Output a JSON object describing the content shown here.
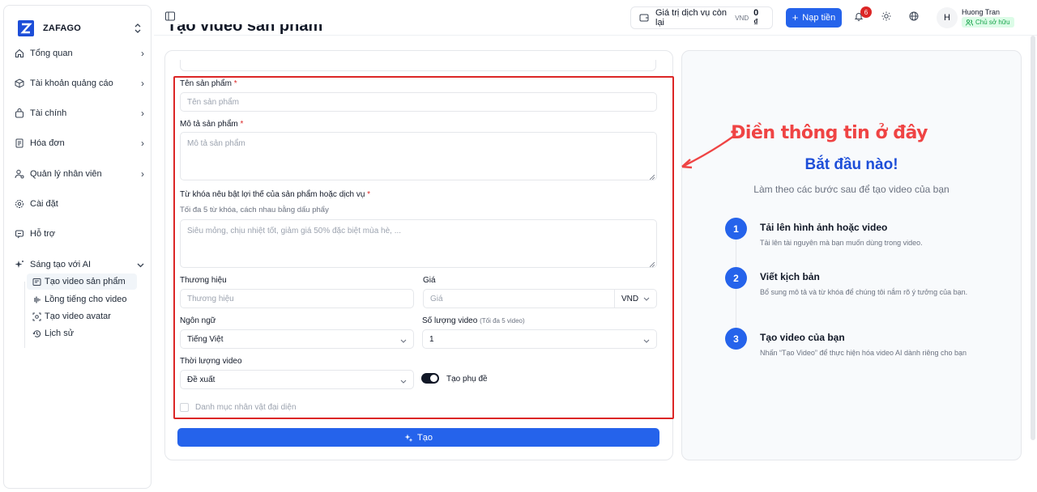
{
  "brand": {
    "name": "ZAFAGO"
  },
  "sidebar": {
    "items": [
      {
        "label": "Tổng quan",
        "icon": "home-icon"
      },
      {
        "label": "Tài khoản quảng cáo",
        "icon": "box-icon"
      },
      {
        "label": "Tài chính",
        "icon": "wallet-icon"
      },
      {
        "label": "Hóa đơn",
        "icon": "receipt-icon"
      },
      {
        "label": "Quản lý nhân viên",
        "icon": "user-cog-icon"
      },
      {
        "label": "Cài đặt",
        "icon": "settings-icon"
      },
      {
        "label": "Hỗ trợ",
        "icon": "support-icon"
      },
      {
        "label": "Sáng tạo với AI",
        "icon": "sparkles-icon"
      }
    ],
    "sub_items": [
      {
        "label": "Tạo video sản phẩm",
        "icon": "video-icon"
      },
      {
        "label": "Lồng tiếng cho video",
        "icon": "audio-wave-icon"
      },
      {
        "label": "Tạo video avatar",
        "icon": "scan-face-icon"
      },
      {
        "label": "Lịch sử",
        "icon": "history-icon"
      }
    ]
  },
  "topbar": {
    "balance_label": "Giá trị dịch vụ còn lại",
    "currency": "VND",
    "balance_value": "0 ₫",
    "topup_label": "Nạp tiền",
    "notification_count": "6",
    "user_initial": "H",
    "user_name": "Huong Tran",
    "user_role": "Chủ sở hữu"
  },
  "page": {
    "title": "Tạo video sản phẩm"
  },
  "form": {
    "product_name_label": "Tên sản phẩm",
    "product_name_placeholder": "Tên sản phẩm",
    "description_label": "Mô tả sản phẩm",
    "description_placeholder": "Mô tả sản phẩm",
    "keywords_label": "Từ khóa nêu bật lợi thế của sản phẩm hoặc dịch vụ",
    "keywords_hint": "Tối đa 5 từ khóa, cách nhau bằng dấu phẩy",
    "keywords_placeholder": "Siêu mỏng, chịu nhiệt tốt, giảm giá 50% đặc biệt mùa hè, ...",
    "required_mark": "*",
    "brand_label": "Thương hiệu",
    "brand_placeholder": "Thương hiệu",
    "price_label": "Giá",
    "price_placeholder": "Giá",
    "price_currency": "VND",
    "language_label": "Ngôn ngữ",
    "language_value": "Tiếng Việt",
    "video_count_label": "Số lượng video",
    "video_count_hint": "(Tối đa 5 video)",
    "video_count_value": "1",
    "duration_label": "Thời lượng video",
    "duration_value": "Đề xuất",
    "subtitle_label": "Tạo phụ đề",
    "subtitle_enabled": true,
    "character_label": "Danh mục nhân vật đại diện",
    "create_label": "Tạo"
  },
  "annotation": {
    "text": "Điền thông tin ở đây",
    "color": "#ef4444"
  },
  "guide": {
    "title": "Bắt đầu nào!",
    "subtitle": "Làm theo các bước sau để tạo video của bạn",
    "steps": [
      {
        "num": "1",
        "title": "Tải lên hình ảnh hoặc video",
        "desc": "Tải lên tài nguyên mà bạn muốn dùng trong video."
      },
      {
        "num": "2",
        "title": "Viết kịch bản",
        "desc": "Bổ sung mô tả và từ khóa để chúng tôi nắm rõ ý tưởng của bạn."
      },
      {
        "num": "3",
        "title": "Tạo video của bạn",
        "desc": "Nhấn “Tạo Video” để thực hiện hóa video AI dành riêng cho bạn"
      }
    ]
  },
  "colors": {
    "accent": "#2563eb",
    "highlight": "#dc2626",
    "success": "#16a34a"
  }
}
